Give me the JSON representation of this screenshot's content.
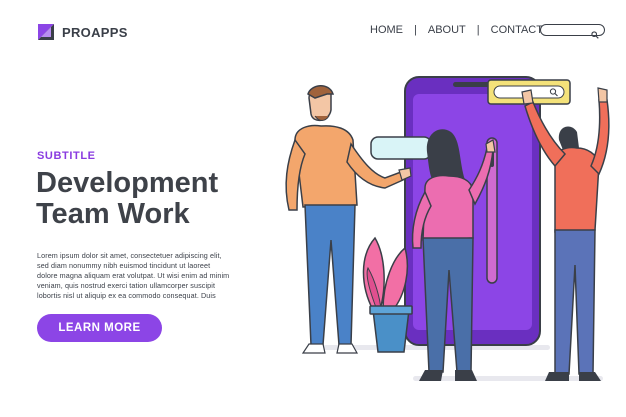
{
  "brand": {
    "name": "PROAPPS",
    "logo_icon": "proapps-logo-icon",
    "accent": "#8c45e6"
  },
  "nav": {
    "items": [
      {
        "label": "HOME"
      },
      {
        "label": "ABOUT"
      },
      {
        "label": "CONTACT"
      }
    ],
    "separator": "|",
    "search": {
      "placeholder": "",
      "icon": "search-icon"
    }
  },
  "hero": {
    "subtitle": "SUBTITLE",
    "title_line1": "Development",
    "title_line2": "Team Work",
    "body_lines": [
      "Lorem ipsum dolor sit amet, consectetuer adipiscing elit,",
      "sed diam nonummy nibh euismod tincidunt ut laoreet",
      "dolore magna aliquam erat volutpat. Ut wisi enim ad minim",
      "veniam, quis nostrud exerci tation ullamcorper suscipit",
      "lobortis nisl ut aliquip ex ea commodo consequat. Duis"
    ],
    "cta_label": "LEARN MORE"
  },
  "colors": {
    "purple": "#8c45e6",
    "dark_purple": "#6a2fc0",
    "text": "#3a3f48",
    "phone_screen": "#7a3ad8",
    "yellow": "#f4e27a",
    "speech_bubble": "#d9f4f7"
  }
}
